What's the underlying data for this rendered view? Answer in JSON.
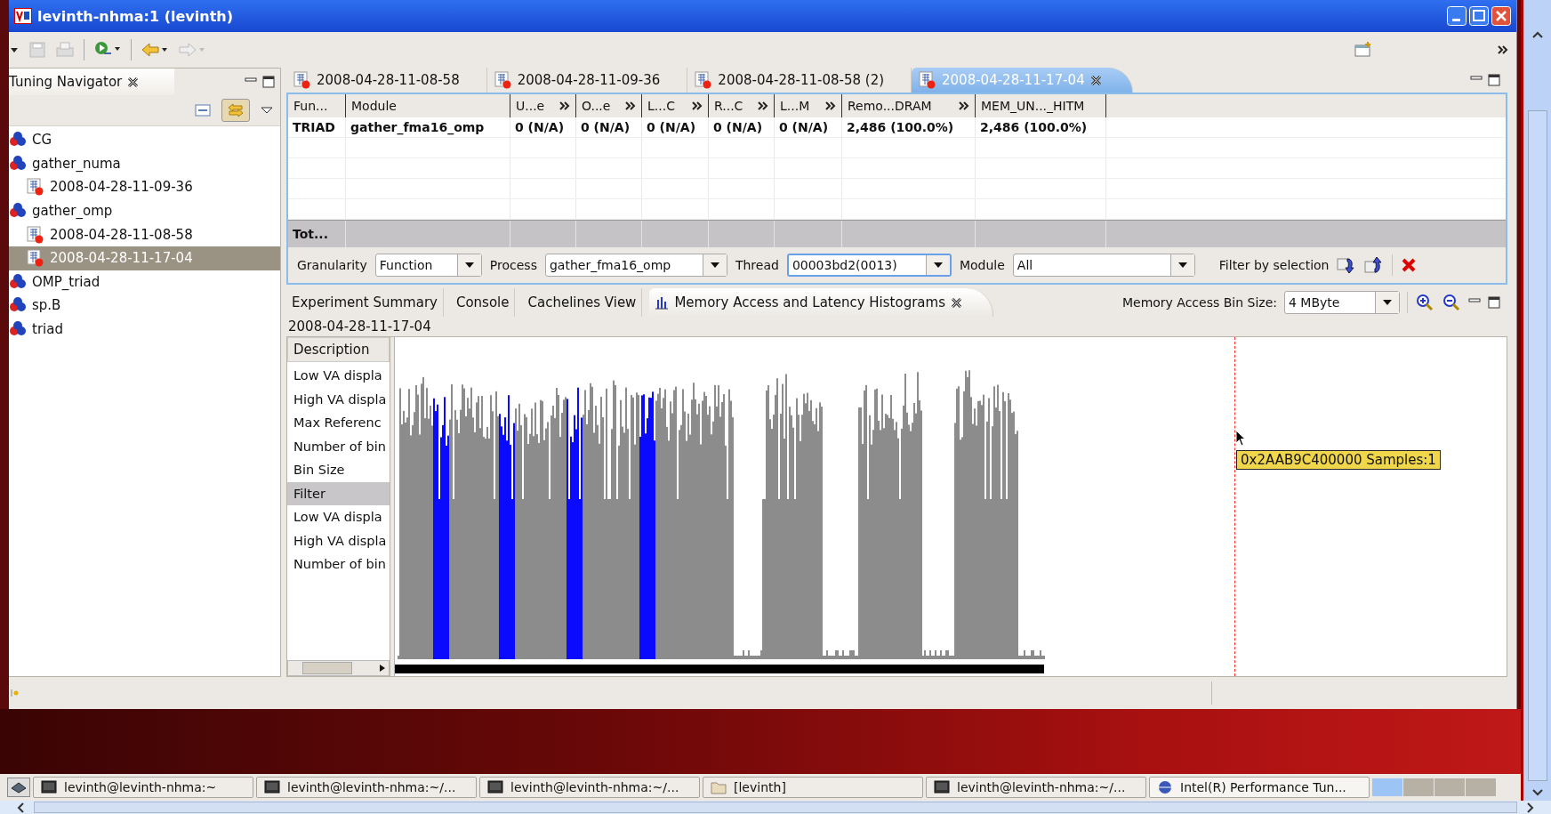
{
  "window": {
    "title": "levinth-nhma:1 (levinth)"
  },
  "navigator": {
    "title": "Tuning Navigator",
    "items": [
      {
        "label": "CG",
        "selected": false
      },
      {
        "label": "gather_numa",
        "selected": false,
        "children": [
          {
            "label": "2008-04-28-11-09-36",
            "selected": false
          }
        ]
      },
      {
        "label": "gather_omp",
        "selected": false,
        "children": [
          {
            "label": "2008-04-28-11-08-58",
            "selected": false
          },
          {
            "label": "2008-04-28-11-17-04",
            "selected": true
          }
        ]
      },
      {
        "label": "OMP_triad",
        "selected": false
      },
      {
        "label": "sp.B",
        "selected": false
      },
      {
        "label": "triad",
        "selected": false
      }
    ]
  },
  "editor_tabs": [
    {
      "label": "2008-04-28-11-08-58",
      "selected": false
    },
    {
      "label": "2008-04-28-11-09-36",
      "selected": false
    },
    {
      "label": "2008-04-28-11-08-58 (2)",
      "selected": false
    },
    {
      "label": "2008-04-28-11-17-04",
      "selected": true
    }
  ],
  "table": {
    "columns": [
      {
        "label": "Fun...",
        "expandable": false
      },
      {
        "label": "Module",
        "expandable": false
      },
      {
        "label": "U...e",
        "expandable": true
      },
      {
        "label": "O...e",
        "expandable": true
      },
      {
        "label": "L...C",
        "expandable": true
      },
      {
        "label": "R...C",
        "expandable": true
      },
      {
        "label": "L...M",
        "expandable": true
      },
      {
        "label": "Remo...DRAM",
        "expandable": true
      },
      {
        "label": "MEM_UN..._HITM",
        "expandable": false
      }
    ],
    "rows": [
      [
        "TRIAD",
        "gather_fma16_omp",
        "0 (N/A)",
        "0 (N/A)",
        "0 (N/A)",
        "0 (N/A)",
        "0 (N/A)",
        "2,486 (100.0%)",
        "2,486 (100.0%)"
      ]
    ],
    "total_label": "Tot..."
  },
  "filters": {
    "granularity": {
      "label": "Granularity",
      "value": "Function"
    },
    "process": {
      "label": "Process",
      "value": "gather_fma16_omp"
    },
    "thread": {
      "label": "Thread",
      "value": "00003bd2(0013)"
    },
    "module": {
      "label": "Module",
      "value": "All"
    },
    "filter_by_selection": "Filter by selection"
  },
  "view_tabs": [
    {
      "label": "Experiment Summary",
      "selected": false
    },
    {
      "label": "Console",
      "selected": false
    },
    {
      "label": "Cachelines View",
      "selected": false
    },
    {
      "label": "Memory Access and Latency Histograms",
      "selected": true
    }
  ],
  "bin_size": {
    "label": "Memory Access Bin Size:",
    "value": "4 MByte"
  },
  "experiment_label": "2008-04-28-11-17-04",
  "description": {
    "header": "Description",
    "items": [
      {
        "label": "Low VA displa",
        "selected": false
      },
      {
        "label": "High VA displa",
        "selected": false
      },
      {
        "label": "Max Referenc",
        "selected": false
      },
      {
        "label": "Number of bin",
        "selected": false
      },
      {
        "label": "Bin Size",
        "selected": false
      },
      {
        "label": "Filter",
        "selected": true
      },
      {
        "label": "Low VA displa",
        "selected": false
      },
      {
        "label": "High VA displa",
        "selected": false
      },
      {
        "label": "Number of bin",
        "selected": false
      }
    ]
  },
  "tooltip": "0x2AAB9C400000 Samples:1",
  "taskbar": [
    {
      "label": "levinth@levinth-nhma:~",
      "kind": "terminal"
    },
    {
      "label": "levinth@levinth-nhma:~/...",
      "kind": "terminal"
    },
    {
      "label": "levinth@levinth-nhma:~/...",
      "kind": "terminal"
    },
    {
      "label": "[levinth]",
      "kind": "folder"
    },
    {
      "label": "levinth@levinth-nhma:~/...",
      "kind": "terminal"
    },
    {
      "label": "Intel(R) Performance Tun...",
      "kind": "app"
    }
  ]
}
